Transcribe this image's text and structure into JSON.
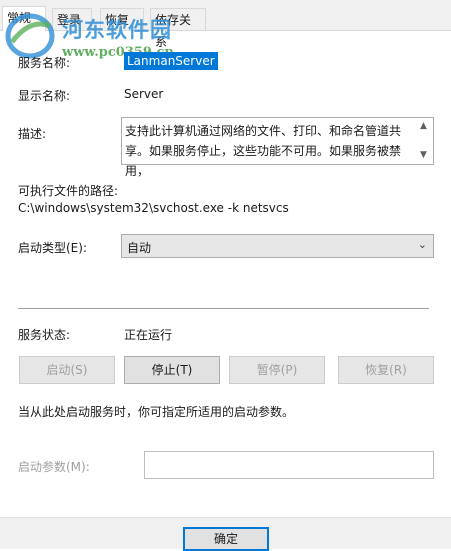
{
  "tabs": [
    "常规",
    "登录",
    "恢复",
    "依存关系"
  ],
  "active_tab": 0,
  "watermark": {
    "name": "河东软件园",
    "url": "www.pc0359.cn"
  },
  "general": {
    "service_name_label": "服务名称:",
    "service_name": "LanmanServer",
    "display_name_label": "显示名称:",
    "display_name": "Server",
    "description_label": "描述:",
    "description": "支持此计算机通过网络的文件、打印、和命名管道共享。如果服务停止，这些功能不可用。如果服务被禁用，",
    "path_label": "可执行文件的路径:",
    "path": "C:\\windows\\system32\\svchost.exe -k netsvcs",
    "startup_type_label": "启动类型(E):",
    "startup_type": "自动"
  },
  "status": {
    "label": "服务状态:",
    "value": "正在运行"
  },
  "buttons": {
    "start": "启动(S)",
    "stop": "停止(T)",
    "pause": "暂停(P)",
    "resume": "恢复(R)"
  },
  "hint": "当从此处启动服务时，你可指定所适用的启动参数。",
  "start_params": {
    "label": "启动参数(M):",
    "value": ""
  },
  "footer": {
    "ok": "确定"
  }
}
